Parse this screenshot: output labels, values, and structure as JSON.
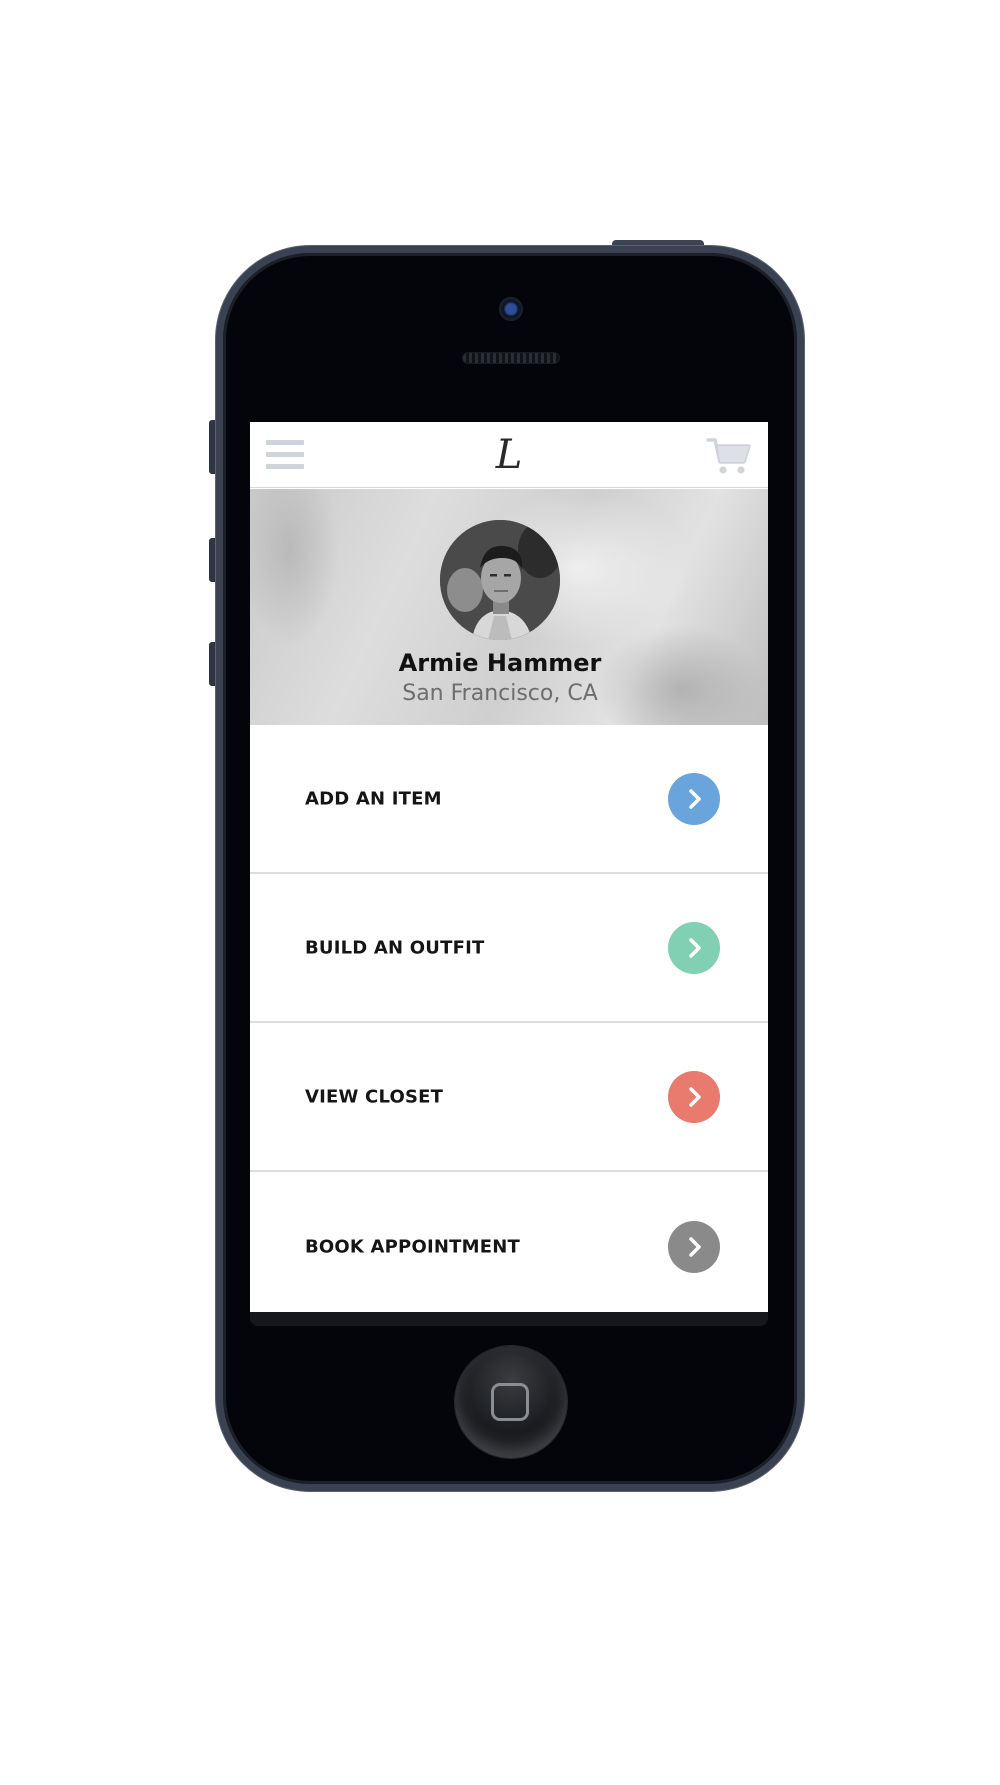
{
  "app": {
    "logo_text": "L"
  },
  "profile": {
    "name": "Armie Hammer",
    "location": "San Francisco, CA"
  },
  "menu": {
    "items": [
      {
        "label": "ADD AN ITEM",
        "color": "#6aa4dc"
      },
      {
        "label": "BUILD AN OUTFIT",
        "color": "#82d0b3"
      },
      {
        "label": "VIEW CLOSET",
        "color": "#e97a6e"
      },
      {
        "label": "BOOK APPOINTMENT",
        "color": "#8a8a8a"
      }
    ]
  },
  "icons": {
    "menu": "hamburger-menu-icon",
    "cart": "shopping-cart-icon",
    "row_arrow": "chevron-right-icon"
  }
}
